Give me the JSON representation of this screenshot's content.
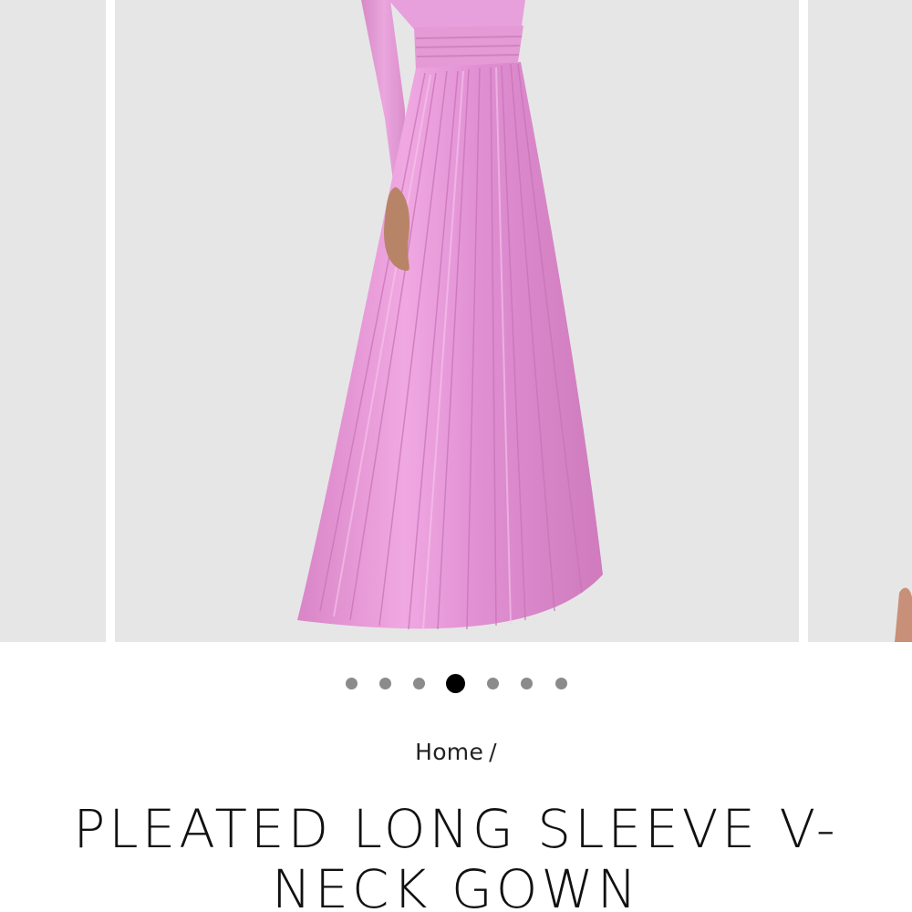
{
  "gallery": {
    "background_color": "#e6e6e7",
    "dress_color": "#e594d6",
    "zoom_icon": "magnifier-icon",
    "slide_count": 7,
    "active_slide": 4
  },
  "breadcrumb": {
    "home": "Home",
    "separator": "/"
  },
  "product": {
    "title": "PLEATED LONG SLEEVE V-NECK GOWN"
  }
}
